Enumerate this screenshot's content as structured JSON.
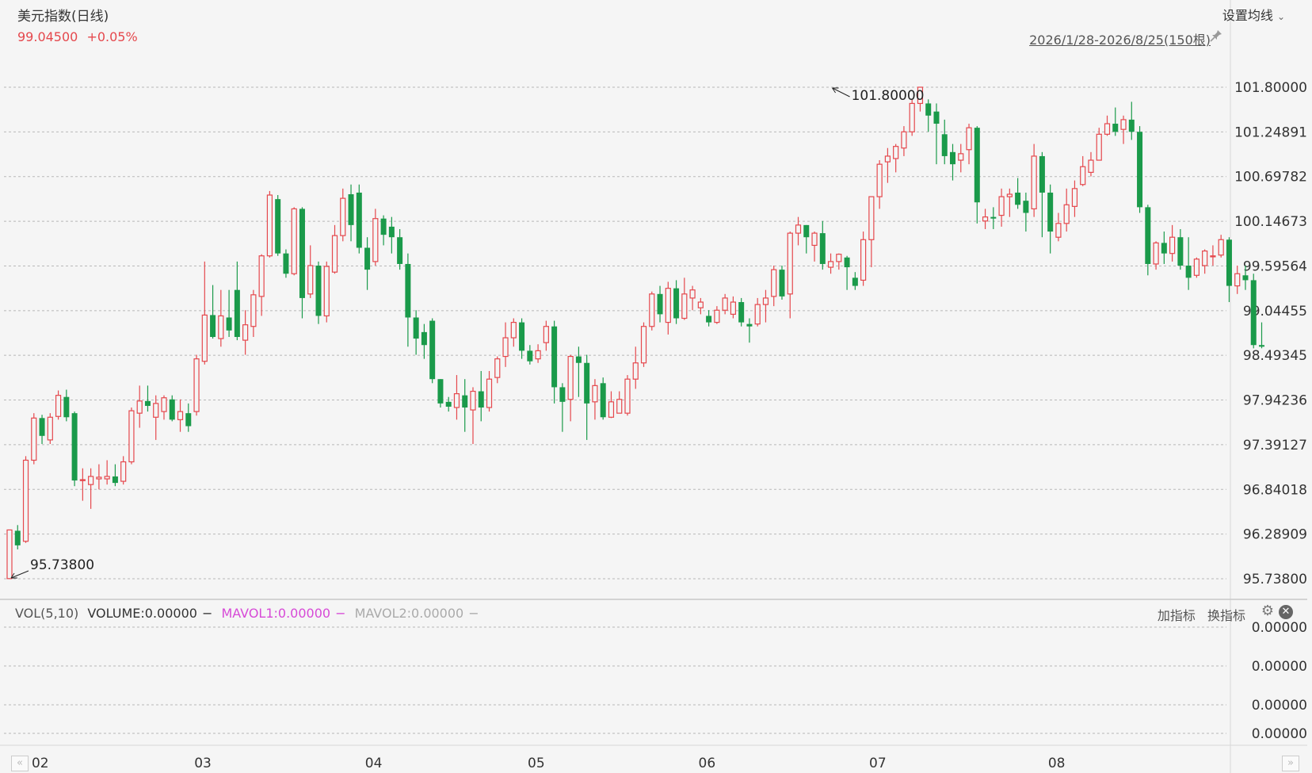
{
  "header": {
    "title": "美元指数(日线)",
    "price": "99.04500",
    "change": "+0.05%",
    "set_ma_label": "设置均线",
    "range_label": "2026/1/28-2026/8/25(150根)"
  },
  "volume_panel": {
    "vol_label": "VOL(5,10)",
    "volume_label": "VOLUME:0.00000",
    "mavol1_label": "MAVOL1:0.00000",
    "mavol2_label": "MAVOL2:0.00000",
    "dash": "−",
    "add_indicator": "加指标",
    "switch_indicator": "换指标",
    "axis_labels": [
      "0.00000",
      "0.00000",
      "0.00000",
      "0.00000"
    ]
  },
  "colors": {
    "up": "#e5484d",
    "down": "#1a9a4a",
    "mavol1": "#d74ad7",
    "mavol2": "#aaaaaa",
    "grid": "#b8b8b8",
    "price_text": "#e5484d"
  },
  "icons": {
    "dropdown": "chevron-down-icon",
    "pin": "pin-icon",
    "gear": "gear-icon",
    "close": "close-icon",
    "nav_left": "double-chevron-left-icon",
    "nav_right": "double-chevron-right-icon"
  },
  "chart_data": {
    "type": "candlestick",
    "y_ticks": [
      101.8,
      101.24891,
      100.69782,
      100.14673,
      99.59564,
      99.04455,
      98.49345,
      97.94236,
      97.39127,
      96.84018,
      96.28909,
      95.738
    ],
    "ylim": [
      95.738,
      101.8
    ],
    "x_ticks": [
      "02",
      "03",
      "04",
      "05",
      "06",
      "07",
      "08"
    ],
    "annotations": [
      {
        "label": "101.80000",
        "value": 101.8,
        "index": 101
      },
      {
        "label": "95.73800",
        "value": 95.738,
        "index": 0
      }
    ],
    "candles": [
      [
        95.74,
        96.34,
        96.26,
        95.738
      ],
      [
        96.33,
        96.15,
        96.4,
        96.1
      ],
      [
        96.2,
        97.2,
        97.25,
        96.18
      ],
      [
        97.2,
        97.72,
        97.78,
        97.15
      ],
      [
        97.72,
        97.5,
        97.76,
        97.4
      ],
      [
        97.45,
        97.73,
        97.78,
        97.4
      ],
      [
        97.74,
        98.0,
        98.06,
        97.7
      ],
      [
        97.98,
        97.73,
        98.07,
        97.68
      ],
      [
        97.78,
        96.95,
        97.8,
        96.88
      ],
      [
        96.95,
        96.96,
        97.1,
        96.7
      ],
      [
        96.9,
        97.0,
        97.1,
        96.6
      ],
      [
        96.97,
        96.99,
        97.15,
        96.84
      ],
      [
        96.97,
        97.0,
        97.2,
        96.9
      ],
      [
        97.0,
        96.92,
        97.15,
        96.88
      ],
      [
        96.94,
        97.18,
        97.25,
        96.9
      ],
      [
        97.18,
        97.81,
        97.85,
        97.15
      ],
      [
        97.78,
        97.93,
        98.12,
        97.6
      ],
      [
        97.93,
        97.87,
        98.12,
        97.8
      ],
      [
        97.73,
        97.9,
        98.0,
        97.45
      ],
      [
        97.8,
        97.97,
        98.0,
        97.7
      ],
      [
        97.95,
        97.7,
        98.0,
        97.68
      ],
      [
        97.7,
        97.8,
        97.95,
        97.55
      ],
      [
        97.78,
        97.62,
        97.9,
        97.55
      ],
      [
        97.8,
        98.45,
        98.5,
        97.75
      ],
      [
        98.42,
        98.99,
        99.65,
        98.38
      ],
      [
        98.99,
        98.72,
        99.36,
        98.7
      ],
      [
        98.7,
        98.98,
        99.3,
        98.6
      ],
      [
        98.96,
        98.8,
        99.3,
        98.72
      ],
      [
        99.3,
        98.72,
        99.65,
        98.68
      ],
      [
        98.68,
        98.87,
        99.05,
        98.5
      ],
      [
        98.85,
        99.24,
        99.3,
        98.72
      ],
      [
        99.22,
        99.72,
        99.74,
        98.98
      ],
      [
        99.72,
        100.47,
        100.52,
        99.7
      ],
      [
        100.42,
        99.75,
        100.47,
        99.72
      ],
      [
        99.75,
        99.5,
        99.8,
        99.45
      ],
      [
        99.5,
        100.3,
        100.32,
        99.48
      ],
      [
        100.3,
        99.2,
        100.32,
        98.95
      ],
      [
        99.25,
        99.6,
        99.85,
        99.2
      ],
      [
        99.6,
        98.98,
        99.65,
        98.88
      ],
      [
        98.98,
        99.59,
        99.65,
        98.9
      ],
      [
        99.52,
        99.97,
        100.1,
        99.5
      ],
      [
        99.97,
        100.43,
        100.55,
        99.9
      ],
      [
        100.48,
        100.1,
        100.6,
        99.9
      ],
      [
        100.5,
        99.82,
        100.6,
        99.75
      ],
      [
        99.82,
        99.55,
        99.95,
        99.3
      ],
      [
        99.65,
        100.18,
        100.3,
        99.6
      ],
      [
        100.18,
        99.98,
        100.22,
        99.85
      ],
      [
        100.08,
        99.95,
        100.2,
        99.75
      ],
      [
        99.95,
        99.62,
        100.05,
        99.55
      ],
      [
        99.62,
        98.96,
        99.75,
        98.6
      ],
      [
        98.96,
        98.7,
        99.05,
        98.5
      ],
      [
        98.78,
        98.62,
        98.88,
        98.45
      ],
      [
        98.92,
        98.2,
        98.95,
        98.15
      ],
      [
        98.2,
        97.9,
        98.2,
        97.85
      ],
      [
        97.92,
        97.86,
        97.98,
        97.8
      ],
      [
        97.85,
        98.02,
        98.25,
        97.7
      ],
      [
        98.0,
        97.85,
        98.2,
        97.55
      ],
      [
        97.82,
        98.05,
        98.1,
        97.4
      ],
      [
        98.05,
        97.85,
        98.3,
        97.68
      ],
      [
        97.85,
        98.2,
        98.3,
        97.8
      ],
      [
        98.22,
        98.45,
        98.48,
        98.15
      ],
      [
        98.48,
        98.71,
        98.9,
        98.35
      ],
      [
        98.71,
        98.9,
        98.95,
        98.6
      ],
      [
        98.9,
        98.55,
        98.95,
        98.45
      ],
      [
        98.55,
        98.42,
        98.62,
        98.38
      ],
      [
        98.45,
        98.55,
        98.63,
        98.4
      ],
      [
        98.65,
        98.85,
        98.92,
        98.55
      ],
      [
        98.85,
        98.1,
        98.92,
        97.9
      ],
      [
        98.1,
        97.92,
        98.15,
        97.55
      ],
      [
        97.95,
        98.48,
        98.5,
        97.68
      ],
      [
        98.48,
        98.4,
        98.6,
        97.98
      ],
      [
        98.4,
        97.9,
        98.5,
        97.45
      ],
      [
        97.92,
        98.12,
        98.2,
        97.7
      ],
      [
        98.15,
        97.73,
        98.22,
        97.7
      ],
      [
        97.73,
        97.92,
        98.05,
        97.72
      ],
      [
        97.78,
        97.95,
        98.05,
        97.82
      ],
      [
        97.78,
        98.2,
        98.25,
        97.75
      ],
      [
        98.2,
        98.4,
        98.6,
        98.08
      ],
      [
        98.4,
        98.85,
        98.9,
        98.35
      ],
      [
        98.85,
        99.25,
        99.28,
        98.8
      ],
      [
        99.25,
        99.0,
        99.35,
        98.9
      ],
      [
        98.9,
        99.32,
        99.4,
        98.75
      ],
      [
        99.32,
        98.95,
        99.42,
        98.88
      ],
      [
        98.95,
        99.25,
        99.45,
        98.93
      ],
      [
        99.2,
        99.3,
        99.35,
        99.05
      ],
      [
        99.08,
        99.15,
        99.2,
        99.0
      ],
      [
        98.98,
        98.9,
        99.05,
        98.85
      ],
      [
        98.9,
        99.05,
        99.1,
        98.88
      ],
      [
        99.05,
        99.2,
        99.25,
        99.0
      ],
      [
        99.0,
        99.15,
        99.22,
        98.95
      ],
      [
        99.15,
        98.9,
        99.2,
        98.85
      ],
      [
        98.88,
        98.85,
        98.95,
        98.65
      ],
      [
        98.88,
        99.12,
        99.2,
        98.85
      ],
      [
        99.12,
        99.2,
        99.3,
        98.9
      ],
      [
        99.22,
        99.55,
        99.6,
        99.1
      ],
      [
        99.55,
        99.22,
        99.6,
        99.18
      ],
      [
        99.25,
        100.0,
        100.02,
        98.95
      ],
      [
        100.0,
        100.1,
        100.2,
        99.85
      ],
      [
        100.1,
        99.95,
        100.1,
        99.75
      ],
      [
        99.85,
        100.0,
        100.02,
        99.65
      ],
      [
        100.0,
        99.62,
        100.15,
        99.55
      ],
      [
        99.58,
        99.65,
        99.75,
        99.5
      ],
      [
        99.65,
        99.74,
        99.75,
        99.55
      ],
      [
        99.7,
        99.58,
        99.72,
        99.3
      ],
      [
        99.45,
        99.35,
        99.52,
        99.3
      ],
      [
        99.42,
        99.92,
        100.02,
        99.35
      ],
      [
        99.92,
        100.45,
        100.45,
        99.58
      ],
      [
        100.45,
        100.85,
        100.9,
        100.3
      ],
      [
        100.88,
        100.95,
        101.05,
        100.62
      ],
      [
        100.92,
        101.07,
        101.1,
        100.75
      ],
      [
        101.05,
        101.25,
        101.32,
        100.95
      ],
      [
        101.25,
        101.6,
        101.65,
        101.2
      ],
      [
        101.6,
        101.8,
        101.8,
        101.5
      ],
      [
        101.6,
        101.45,
        101.65,
        101.25
      ],
      [
        101.5,
        101.35,
        101.6,
        100.85
      ],
      [
        101.22,
        100.95,
        101.4,
        100.85
      ],
      [
        101.0,
        100.85,
        101.1,
        100.65
      ],
      [
        100.9,
        100.98,
        101.1,
        100.75
      ],
      [
        101.03,
        101.3,
        101.35,
        100.85
      ],
      [
        101.3,
        100.38,
        101.32,
        100.12
      ],
      [
        100.15,
        100.2,
        100.3,
        100.05
      ],
      [
        100.2,
        100.18,
        100.32,
        100.05
      ],
      [
        100.22,
        100.45,
        100.55,
        100.08
      ],
      [
        100.45,
        100.48,
        100.55,
        100.2
      ],
      [
        100.5,
        100.35,
        100.68,
        100.3
      ],
      [
        100.4,
        100.25,
        100.5,
        100.02
      ],
      [
        100.3,
        100.95,
        101.1,
        100.2
      ],
      [
        100.95,
        100.5,
        101.0,
        99.95
      ],
      [
        100.5,
        100.02,
        100.6,
        99.75
      ],
      [
        99.95,
        100.12,
        100.25,
        99.9
      ],
      [
        100.12,
        100.35,
        100.55,
        100.02
      ],
      [
        100.33,
        100.55,
        100.65,
        100.2
      ],
      [
        100.6,
        100.82,
        100.95,
        100.58
      ],
      [
        100.75,
        100.9,
        101.0,
        100.7
      ],
      [
        100.9,
        101.22,
        101.3,
        100.9
      ],
      [
        101.22,
        101.35,
        101.45,
        101.2
      ],
      [
        101.35,
        101.25,
        101.55,
        101.2
      ],
      [
        101.28,
        101.4,
        101.45,
        101.1
      ],
      [
        101.4,
        101.25,
        101.62,
        101.15
      ],
      [
        101.25,
        100.32,
        101.32,
        100.25
      ],
      [
        100.32,
        99.62,
        100.35,
        99.48
      ],
      [
        99.62,
        99.88,
        99.9,
        99.55
      ],
      [
        99.88,
        99.75,
        100.02,
        99.62
      ],
      [
        99.75,
        99.95,
        100.1,
        99.65
      ],
      [
        99.95,
        99.6,
        100.05,
        99.55
      ],
      [
        99.6,
        99.45,
        99.95,
        99.3
      ],
      [
        99.48,
        99.68,
        99.7,
        99.45
      ],
      [
        99.6,
        99.78,
        99.8,
        99.5
      ],
      [
        99.72,
        99.72,
        99.85,
        99.6
      ],
      [
        99.73,
        99.92,
        99.98,
        99.7
      ],
      [
        99.92,
        99.35,
        99.95,
        99.15
      ],
      [
        99.35,
        99.5,
        99.6,
        99.25
      ],
      [
        99.48,
        99.42,
        99.6,
        99.3
      ],
      [
        99.42,
        98.62,
        99.5,
        98.58
      ],
      [
        98.62,
        98.6,
        98.9,
        98.58
      ]
    ]
  }
}
